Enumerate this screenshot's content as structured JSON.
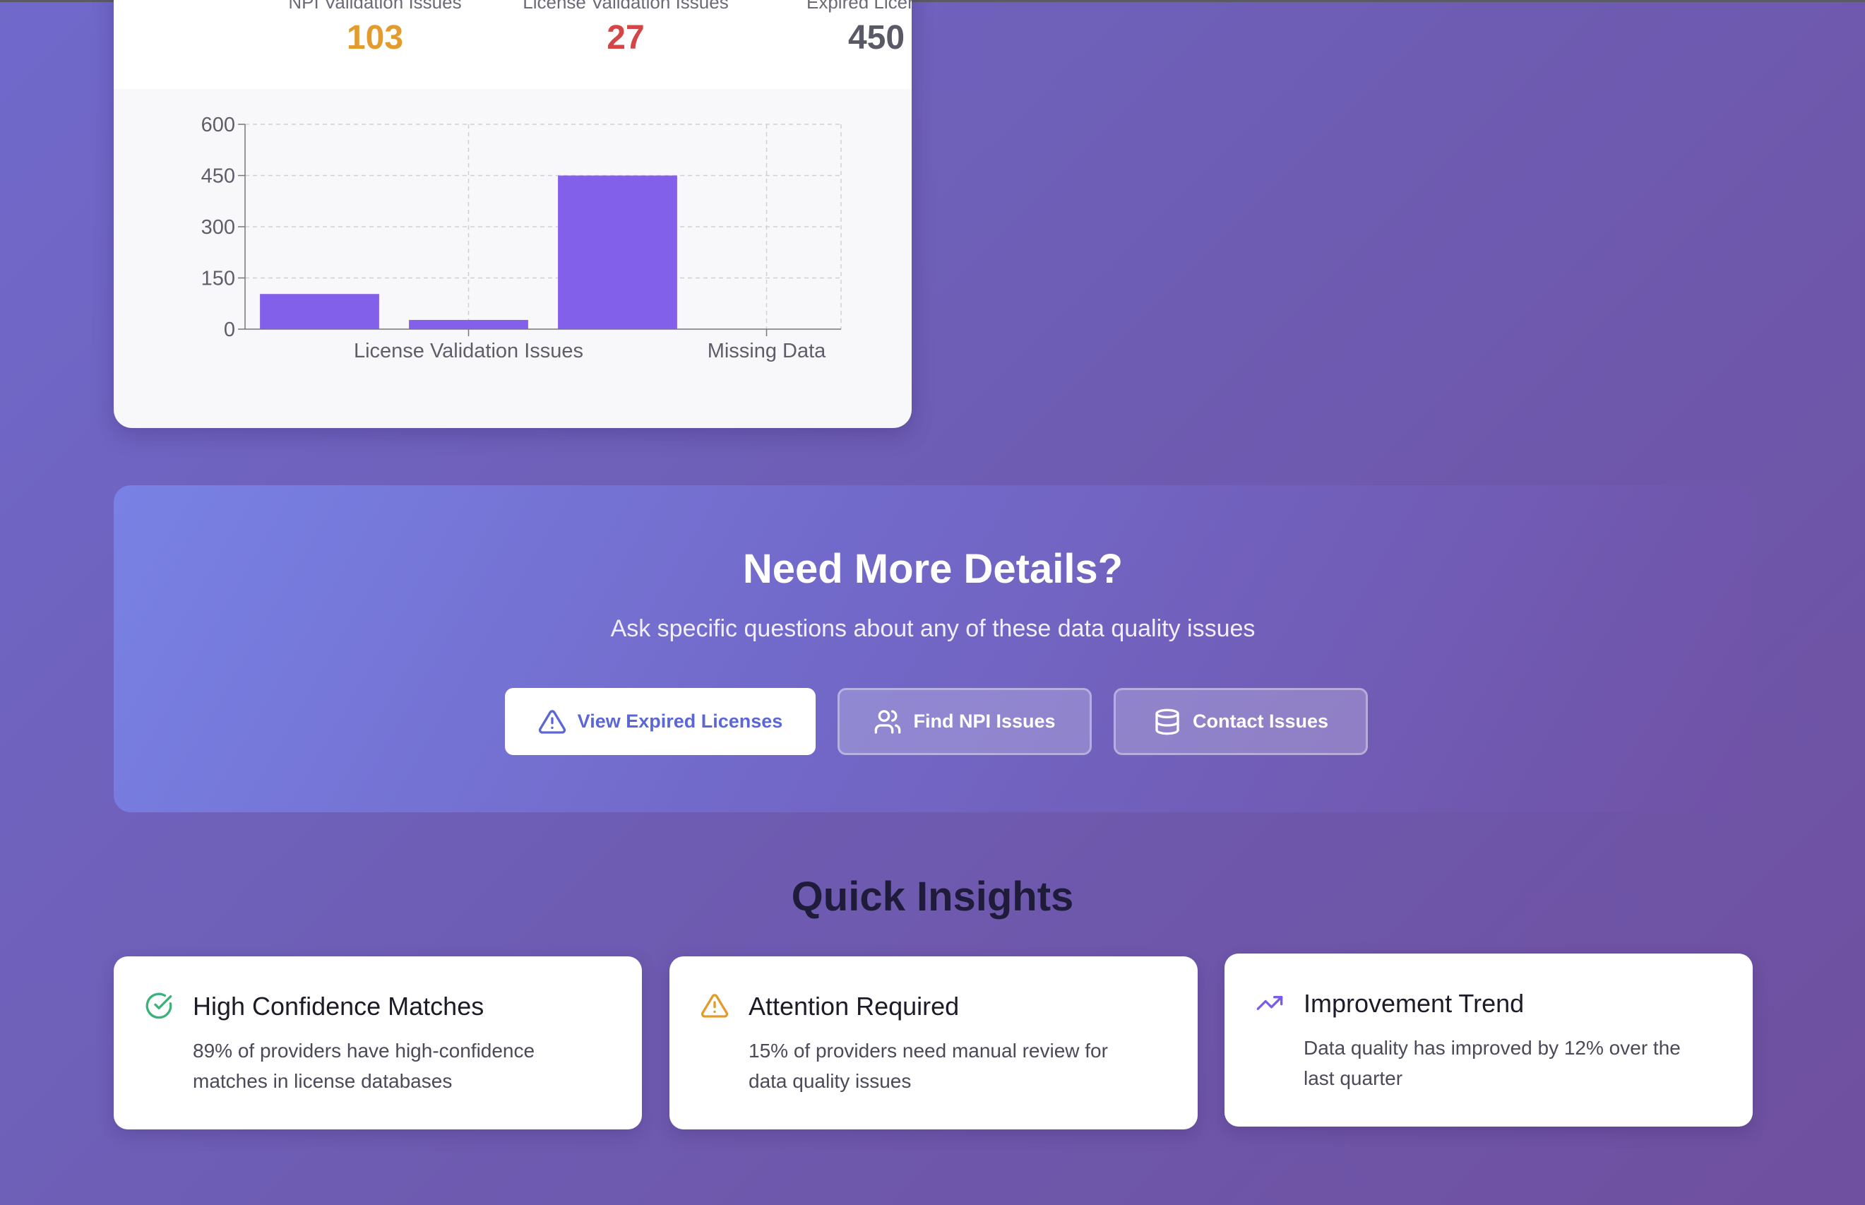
{
  "summary": {
    "stats": [
      {
        "label": "NPI Validation Issues",
        "value": "103",
        "color": "#e39b2d"
      },
      {
        "label": "License Validation Issues",
        "value": "27",
        "color": "#d64545"
      },
      {
        "label": "Expired Licenses",
        "value": "450",
        "color": "#5a5a66"
      }
    ]
  },
  "chart_data": {
    "type": "bar",
    "categories": [
      "NPI Validation Issues",
      "License Validation Issues",
      "Expired Licenses",
      "Missing Data"
    ],
    "visible_tick_labels": [
      "License Validation Issues",
      "Missing Data"
    ],
    "values": [
      103,
      27,
      450,
      0
    ],
    "y_ticks": [
      0,
      150,
      300,
      450,
      600
    ],
    "ylim": [
      0,
      600
    ],
    "grid": true,
    "bar_color": "#8360ea"
  },
  "cta": {
    "title": "Need More Details?",
    "subtitle": "Ask specific questions about any of these data quality issues",
    "buttons": {
      "expired": "View Expired Licenses",
      "npi": "Find NPI Issues",
      "contact": "Contact Issues"
    }
  },
  "insights": {
    "title": "Quick Insights",
    "cards": [
      {
        "title": "High Confidence Matches",
        "text": "89% of providers have high-confidence matches in license databases",
        "icon": "check-circle-icon",
        "icon_color": "#3bb27a"
      },
      {
        "title": "Attention Required",
        "text": "15% of providers need manual review for data quality issues",
        "icon": "warning-icon",
        "icon_color": "#e39b2d"
      },
      {
        "title": "Improvement Trend",
        "text": "Data quality has improved by 12% over the last quarter",
        "icon": "trending-up-icon",
        "icon_color": "#7c5ce6"
      }
    ]
  }
}
